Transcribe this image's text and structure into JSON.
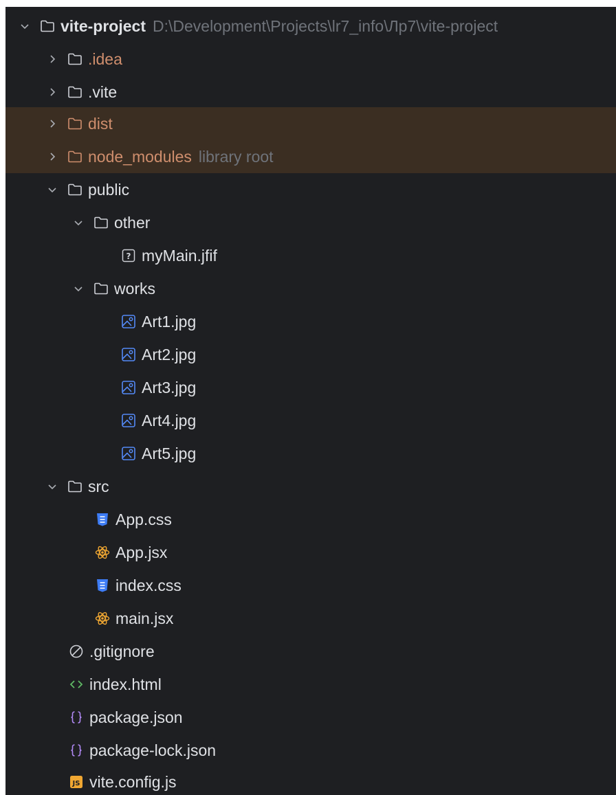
{
  "colors": {
    "background": "#1e1f22",
    "text": "#dfe1e5",
    "excluded_text": "#cf8e6d",
    "excluded_row": "#3b2e22",
    "hint": "#6f737a",
    "image_icon": "#548af7",
    "css_icon": "#3d7cf5",
    "html_icon": "#5fb865",
    "json_icon": "#b189f5",
    "js_icon": "#f0a732"
  },
  "tree": {
    "root": {
      "name": "vite-project",
      "path": "D:\\Development\\Projects\\lr7_info\\Лр7\\vite-project",
      "icon": "folder-icon"
    },
    "idea": {
      "name": ".idea",
      "icon": "folder-icon"
    },
    "vite": {
      "name": ".vite",
      "icon": "folder-icon"
    },
    "dist": {
      "name": "dist",
      "icon": "folder-icon"
    },
    "node_modules": {
      "name": "node_modules",
      "hint": "library root",
      "icon": "folder-icon"
    },
    "public": {
      "name": "public",
      "icon": "folder-icon"
    },
    "other": {
      "name": "other",
      "icon": "folder-icon"
    },
    "mymain": {
      "name": "myMain.jfif",
      "icon": "unknown-file-icon"
    },
    "works": {
      "name": "works",
      "icon": "folder-icon"
    },
    "art1": {
      "name": "Art1.jpg",
      "icon": "image-file-icon"
    },
    "art2": {
      "name": "Art2.jpg",
      "icon": "image-file-icon"
    },
    "art3": {
      "name": "Art3.jpg",
      "icon": "image-file-icon"
    },
    "art4": {
      "name": "Art4.jpg",
      "icon": "image-file-icon"
    },
    "art5": {
      "name": "Art5.jpg",
      "icon": "image-file-icon"
    },
    "src": {
      "name": "src",
      "icon": "folder-icon"
    },
    "app_css": {
      "name": "App.css",
      "icon": "css-file-icon"
    },
    "app_jsx": {
      "name": "App.jsx",
      "icon": "react-file-icon"
    },
    "index_css": {
      "name": "index.css",
      "icon": "css-file-icon"
    },
    "main_jsx": {
      "name": "main.jsx",
      "icon": "react-file-icon"
    },
    "gitignore": {
      "name": ".gitignore",
      "icon": "ignore-file-icon"
    },
    "index_html": {
      "name": "index.html",
      "icon": "html-file-icon"
    },
    "package_json": {
      "name": "package.json",
      "icon": "json-file-icon"
    },
    "package_lock": {
      "name": "package-lock.json",
      "icon": "json-file-icon"
    },
    "vite_config": {
      "name": "vite.config.js",
      "icon": "js-file-icon"
    }
  }
}
